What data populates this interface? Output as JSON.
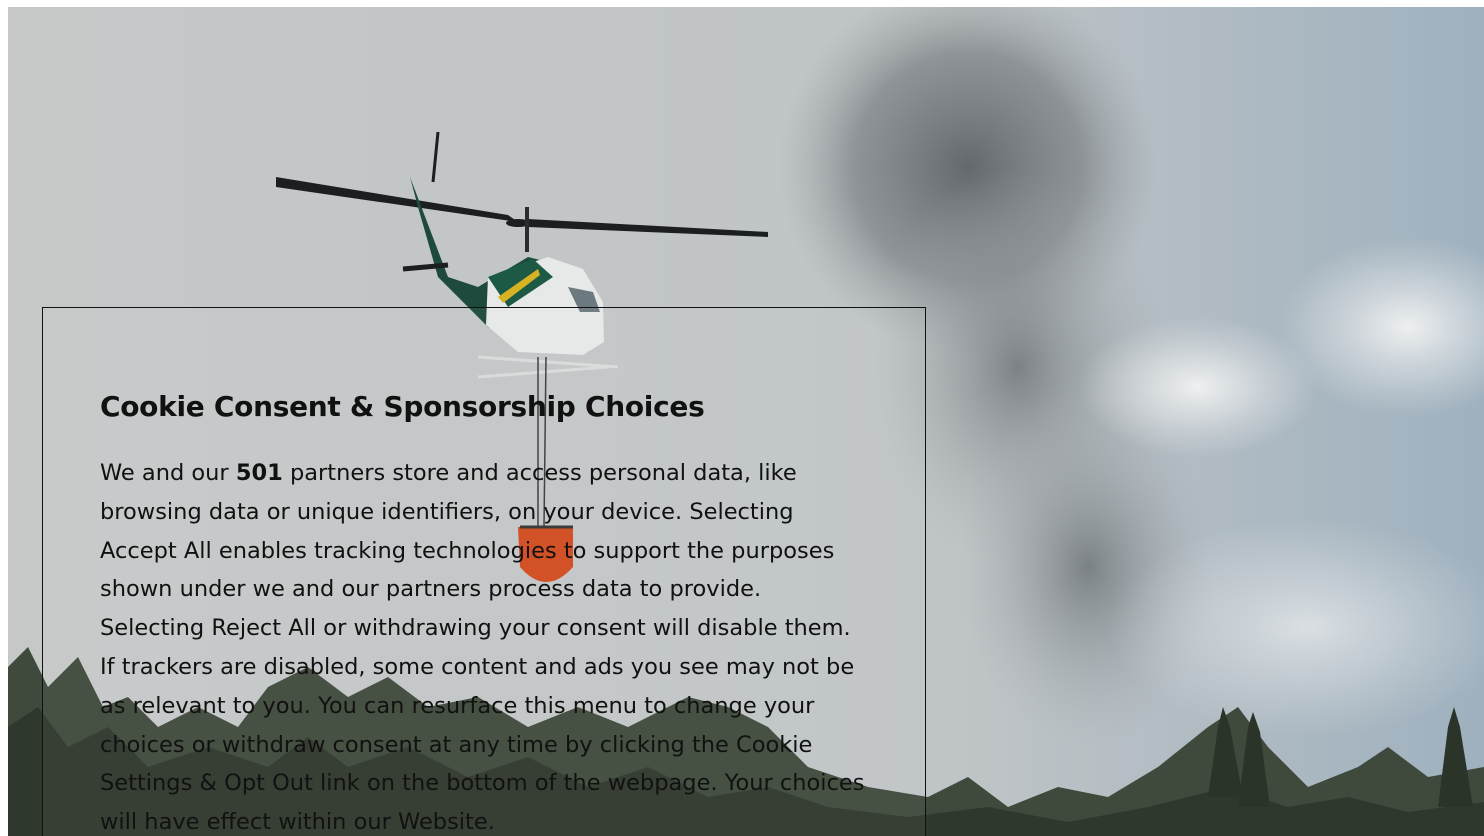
{
  "background_image": {
    "subject": "helicopter-with-water-bucket-over-smoke"
  },
  "consent_dialog": {
    "title": "Cookie Consent & Sponsorship Choices",
    "body_prefix": "We and our ",
    "partner_count": "501",
    "body_text": " partners store and access personal data, like browsing data or unique identifiers, on your device. Selecting Accept All enables tracking technologies to support the purposes shown under we and our partners process data to provide. Selecting Reject All or withdrawing your consent will disable them. If trackers are disabled, some content and ads you see may not be as relevant to you. You can resurface this menu to change your choices or withdraw consent at any time by clicking the Cookie Settings & Opt Out link on the bottom of the webpage. Your choices will have effect within our Website."
  },
  "colors": {
    "text": "#111111",
    "dialog_border": "#111111",
    "sky": "#c4c7c8"
  }
}
